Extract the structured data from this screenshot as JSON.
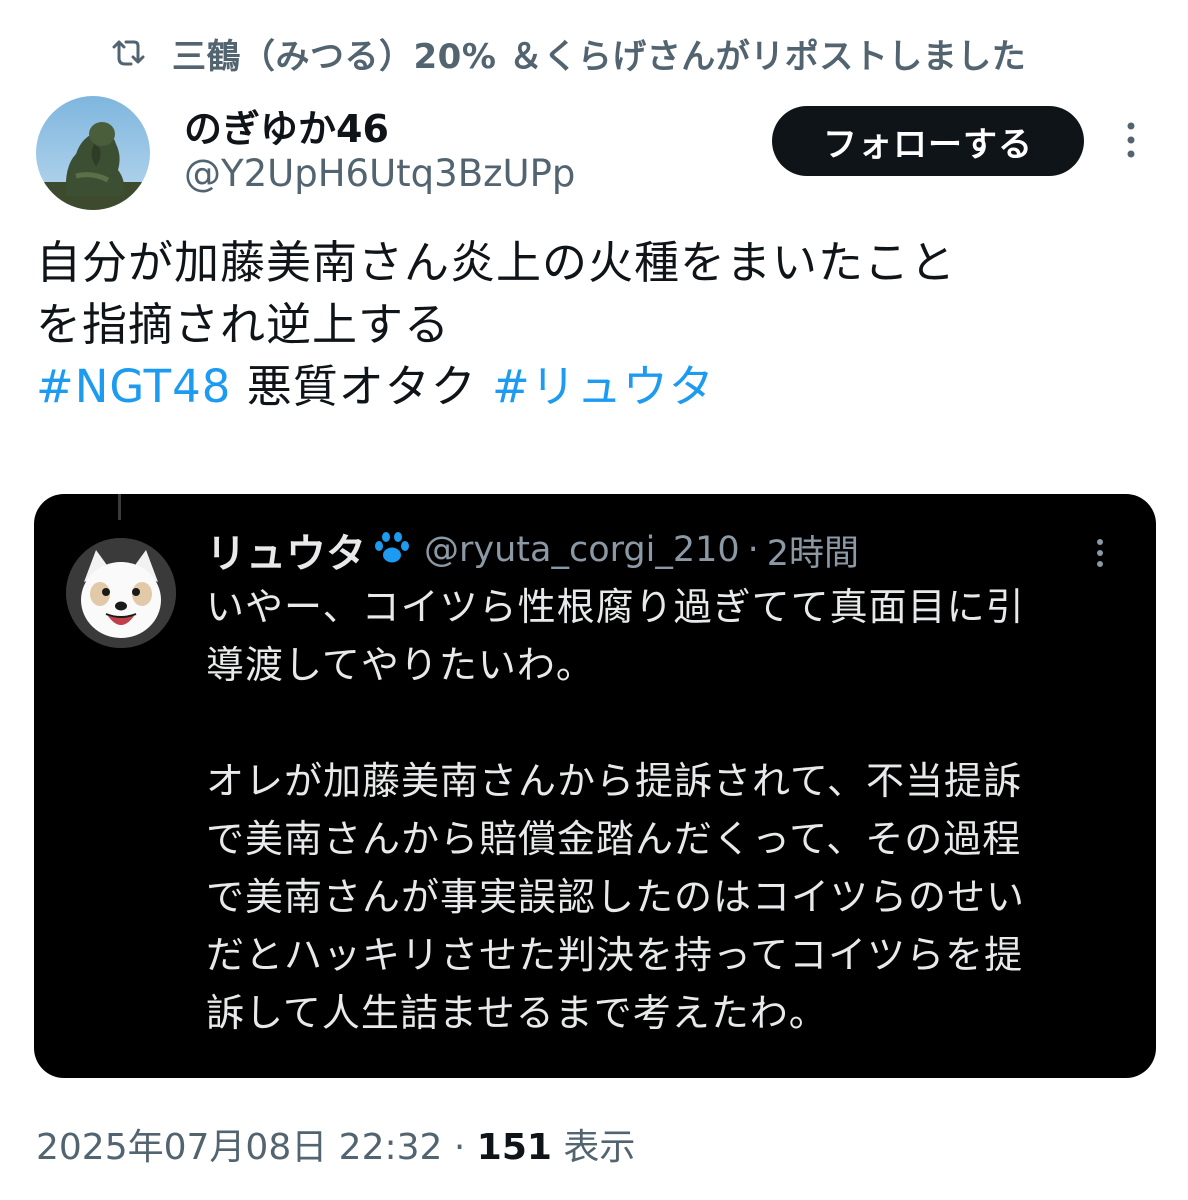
{
  "repost": {
    "text": "三鶴（みつる）20% ＆くらげさんがリポストしました",
    "icon": "repost-icon"
  },
  "author": {
    "name": "のぎゆか46",
    "handle": "@Y2UpH6Utq3BzUPp",
    "avatar": "statue-avatar"
  },
  "actions": {
    "follow_label": "フォローする",
    "more_icon": "more-vertical-icon"
  },
  "tweet": {
    "line1": "自分が加藤美南さん炎上の火種をまいたこと",
    "line2": "を指摘され逆上する",
    "hashtag1": "#NGT48",
    "middle_text": " 悪質オタク ",
    "hashtag2": "#リュウタ"
  },
  "quoted": {
    "name": "リュウタ",
    "paw_icon": "paw-icon",
    "handle": "@ryuta_corgi_210",
    "separator": "·",
    "time": "2時間",
    "lines": [
      "いやー、コイツら性根腐り過ぎてて真面目に引",
      "導渡してやりたいわ。",
      "",
      "オレが加藤美南さんから提訴されて、不当提訴",
      "で美南さんから賠償金踏んだくって、その過程",
      "で美南さんが事実誤認したのはコイツらのせい",
      "だとハッキリさせた判決を持ってコイツらを提",
      "訴して人生詰ませるまで考えたわ。"
    ]
  },
  "meta": {
    "timestamp": "2025年07月08日 22:32",
    "separator": " · ",
    "views_count": "151",
    "views_label": " 表示"
  },
  "colors": {
    "hashtag": "#1d9bf0",
    "follow_bg": "#0f1419",
    "secondary_text": "#536471",
    "card_bg": "#000000",
    "paw": "#1d9bf0"
  }
}
